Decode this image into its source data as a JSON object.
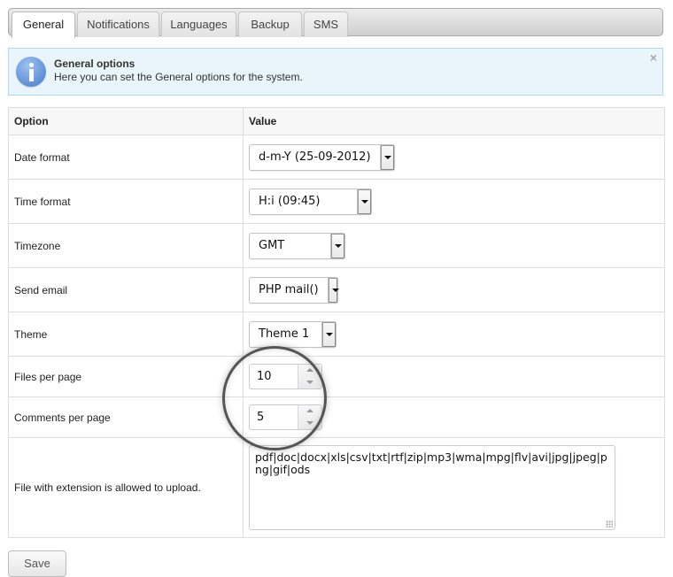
{
  "tabs": [
    {
      "label": "General",
      "active": true
    },
    {
      "label": "Notifications",
      "active": false
    },
    {
      "label": "Languages",
      "active": false
    },
    {
      "label": "Backup",
      "active": false
    },
    {
      "label": "SMS",
      "active": false
    }
  ],
  "info": {
    "icon": "info-icon",
    "title": "General options",
    "text": "Here you can set the General options for the system.",
    "close": "×"
  },
  "table": {
    "headers": {
      "option": "Option",
      "value": "Value"
    },
    "rows": [
      {
        "label": "Date format",
        "type": "select",
        "value": "d-m-Y (25-09-2012)"
      },
      {
        "label": "Time format",
        "type": "select",
        "value": "H:i (09:45)"
      },
      {
        "label": "Timezone",
        "type": "select",
        "value": "GMT"
      },
      {
        "label": "Send email",
        "type": "select",
        "value": "PHP mail()"
      },
      {
        "label": "Theme",
        "type": "select",
        "value": "Theme 1"
      },
      {
        "label": "Files per page",
        "type": "spinner",
        "value": "10"
      },
      {
        "label": "Comments per page",
        "type": "spinner",
        "value": "5"
      },
      {
        "label": "File with extension is allowed to upload.",
        "type": "textarea",
        "value": "pdf|doc|docx|xls|csv|txt|rtf|zip|mp3|wma|mpg|flv|avi|jpg|jpeg|png|gif|ods"
      }
    ]
  },
  "save_label": "Save"
}
